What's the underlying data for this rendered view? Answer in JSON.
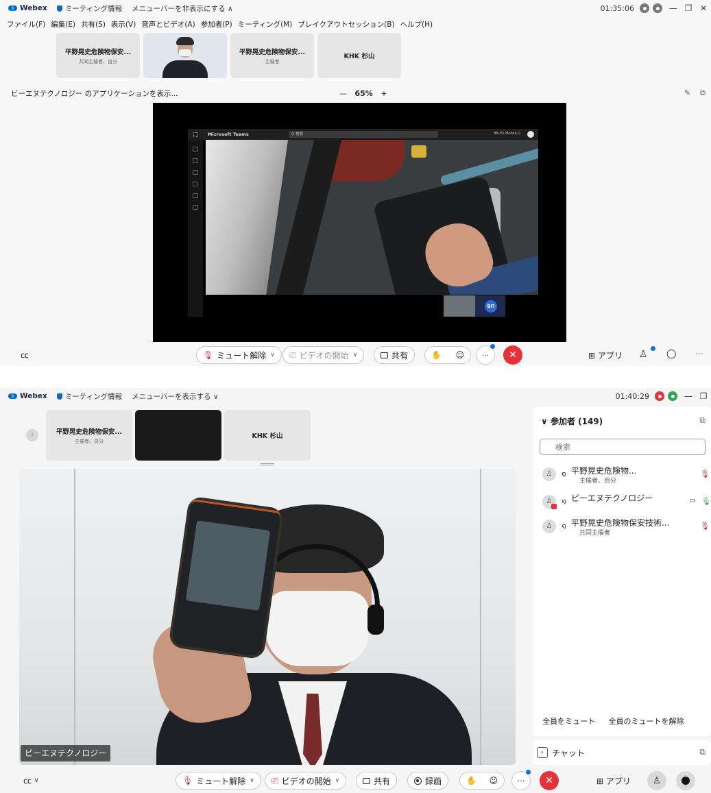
{
  "window1": {
    "app_name": "Webex",
    "meeting_info": "ミーティング情報",
    "menubar_toggle": "メニューバーを非表示にする ∧",
    "clock": "01:35:06",
    "menu": [
      "ファイル(F)",
      "編集(E)",
      "共有(S)",
      "表示(V)",
      "音声とビデオ(A)",
      "参加者(P)",
      "ミーティング(M)",
      "ブレイクアウトセッション(B)",
      "ヘルプ(H)"
    ],
    "tiles": [
      {
        "name": "平野晃史危険物保安...",
        "role": "共同主催者、自分"
      },
      {
        "name": "平野晃史危険物保安...",
        "role": "主催者"
      },
      {
        "name": "KHK 杉山",
        "role": ""
      }
    ],
    "share_label": "ビーエヌテクノロジー のアプリケーションを表示...",
    "zoom_minus": "—",
    "zoom_level": "65%",
    "zoom_plus": "+",
    "teams": {
      "title": "Microsoft Teams",
      "search": "Q 検索",
      "user": "BN EX Mobile G",
      "pip_logo": "ВП"
    },
    "controls": {
      "unmute": "ミュート解除",
      "start_video": "ビデオの開始",
      "share": "共有",
      "apps": "アプリ"
    }
  },
  "window2": {
    "app_name": "Webex",
    "meeting_info": "ミーティング情報",
    "menubar_toggle": "メニューバーを表示する ∨",
    "clock": "01:40:29",
    "tiles": [
      {
        "name": "平野晃史危険物保安...",
        "role": "主催者、自分"
      },
      {
        "name": "KHK 杉山",
        "role": ""
      }
    ],
    "stage_label": "ビーエヌテクノロジー",
    "participants": {
      "title": "参加者 (149)",
      "search_placeholder": "検索",
      "list": [
        {
          "name": "平野晃史危険物...",
          "role": "主催者、自分"
        },
        {
          "name": "ビーエヌテクノロジー",
          "role": ""
        },
        {
          "name": "平野晃史危険物保安技術...",
          "role": "共同主催者"
        }
      ],
      "mute_all": "全員をミュート",
      "unmute_all": "全員のミュートを解除"
    },
    "chat": "チャット",
    "controls": {
      "unmute": "ミュート解除",
      "start_video": "ビデオの開始",
      "share": "共有",
      "record": "録画",
      "apps": "アプリ"
    }
  },
  "colors": {
    "end_call": "#e5323a",
    "accent": "#1170cf",
    "status_green": "#30a451"
  }
}
